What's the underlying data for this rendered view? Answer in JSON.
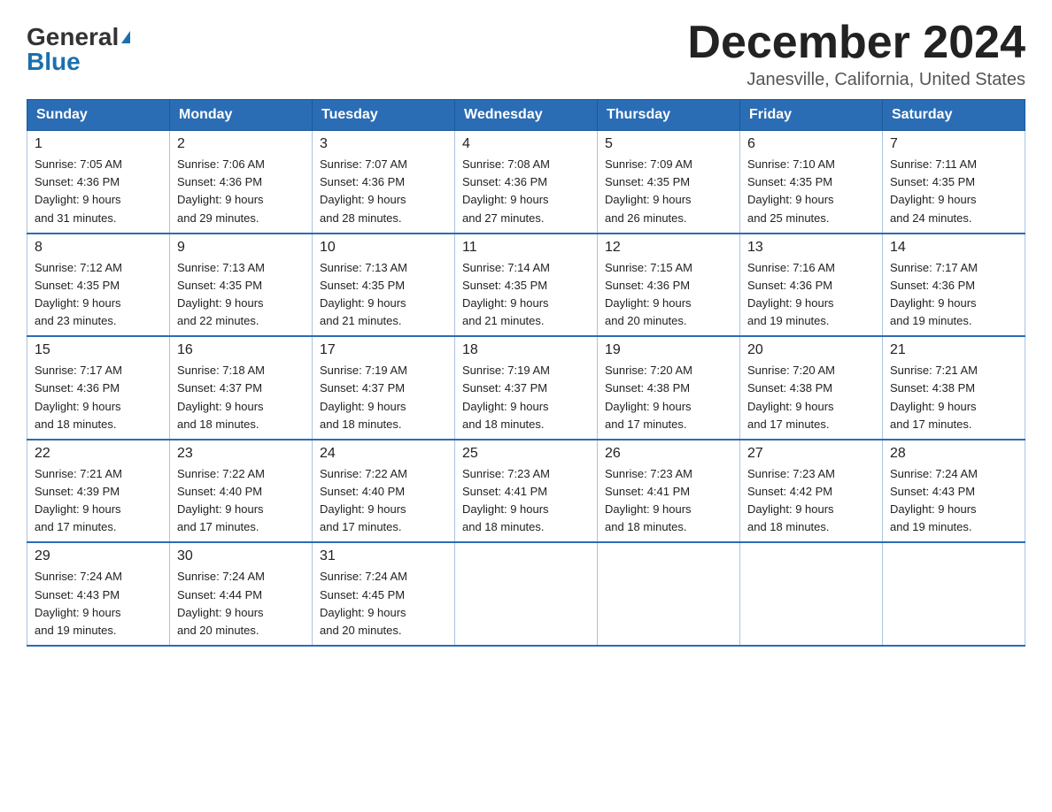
{
  "logo": {
    "general": "General",
    "blue": "Blue"
  },
  "title": "December 2024",
  "location": "Janesville, California, United States",
  "days_of_week": [
    "Sunday",
    "Monday",
    "Tuesday",
    "Wednesday",
    "Thursday",
    "Friday",
    "Saturday"
  ],
  "weeks": [
    [
      {
        "day": "1",
        "sunrise": "7:05 AM",
        "sunset": "4:36 PM",
        "daylight": "9 hours and 31 minutes."
      },
      {
        "day": "2",
        "sunrise": "7:06 AM",
        "sunset": "4:36 PM",
        "daylight": "9 hours and 29 minutes."
      },
      {
        "day": "3",
        "sunrise": "7:07 AM",
        "sunset": "4:36 PM",
        "daylight": "9 hours and 28 minutes."
      },
      {
        "day": "4",
        "sunrise": "7:08 AM",
        "sunset": "4:36 PM",
        "daylight": "9 hours and 27 minutes."
      },
      {
        "day": "5",
        "sunrise": "7:09 AM",
        "sunset": "4:35 PM",
        "daylight": "9 hours and 26 minutes."
      },
      {
        "day": "6",
        "sunrise": "7:10 AM",
        "sunset": "4:35 PM",
        "daylight": "9 hours and 25 minutes."
      },
      {
        "day": "7",
        "sunrise": "7:11 AM",
        "sunset": "4:35 PM",
        "daylight": "9 hours and 24 minutes."
      }
    ],
    [
      {
        "day": "8",
        "sunrise": "7:12 AM",
        "sunset": "4:35 PM",
        "daylight": "9 hours and 23 minutes."
      },
      {
        "day": "9",
        "sunrise": "7:13 AM",
        "sunset": "4:35 PM",
        "daylight": "9 hours and 22 minutes."
      },
      {
        "day": "10",
        "sunrise": "7:13 AM",
        "sunset": "4:35 PM",
        "daylight": "9 hours and 21 minutes."
      },
      {
        "day": "11",
        "sunrise": "7:14 AM",
        "sunset": "4:35 PM",
        "daylight": "9 hours and 21 minutes."
      },
      {
        "day": "12",
        "sunrise": "7:15 AM",
        "sunset": "4:36 PM",
        "daylight": "9 hours and 20 minutes."
      },
      {
        "day": "13",
        "sunrise": "7:16 AM",
        "sunset": "4:36 PM",
        "daylight": "9 hours and 19 minutes."
      },
      {
        "day": "14",
        "sunrise": "7:17 AM",
        "sunset": "4:36 PM",
        "daylight": "9 hours and 19 minutes."
      }
    ],
    [
      {
        "day": "15",
        "sunrise": "7:17 AM",
        "sunset": "4:36 PM",
        "daylight": "9 hours and 18 minutes."
      },
      {
        "day": "16",
        "sunrise": "7:18 AM",
        "sunset": "4:37 PM",
        "daylight": "9 hours and 18 minutes."
      },
      {
        "day": "17",
        "sunrise": "7:19 AM",
        "sunset": "4:37 PM",
        "daylight": "9 hours and 18 minutes."
      },
      {
        "day": "18",
        "sunrise": "7:19 AM",
        "sunset": "4:37 PM",
        "daylight": "9 hours and 18 minutes."
      },
      {
        "day": "19",
        "sunrise": "7:20 AM",
        "sunset": "4:38 PM",
        "daylight": "9 hours and 17 minutes."
      },
      {
        "day": "20",
        "sunrise": "7:20 AM",
        "sunset": "4:38 PM",
        "daylight": "9 hours and 17 minutes."
      },
      {
        "day": "21",
        "sunrise": "7:21 AM",
        "sunset": "4:38 PM",
        "daylight": "9 hours and 17 minutes."
      }
    ],
    [
      {
        "day": "22",
        "sunrise": "7:21 AM",
        "sunset": "4:39 PM",
        "daylight": "9 hours and 17 minutes."
      },
      {
        "day": "23",
        "sunrise": "7:22 AM",
        "sunset": "4:40 PM",
        "daylight": "9 hours and 17 minutes."
      },
      {
        "day": "24",
        "sunrise": "7:22 AM",
        "sunset": "4:40 PM",
        "daylight": "9 hours and 17 minutes."
      },
      {
        "day": "25",
        "sunrise": "7:23 AM",
        "sunset": "4:41 PM",
        "daylight": "9 hours and 18 minutes."
      },
      {
        "day": "26",
        "sunrise": "7:23 AM",
        "sunset": "4:41 PM",
        "daylight": "9 hours and 18 minutes."
      },
      {
        "day": "27",
        "sunrise": "7:23 AM",
        "sunset": "4:42 PM",
        "daylight": "9 hours and 18 minutes."
      },
      {
        "day": "28",
        "sunrise": "7:24 AM",
        "sunset": "4:43 PM",
        "daylight": "9 hours and 19 minutes."
      }
    ],
    [
      {
        "day": "29",
        "sunrise": "7:24 AM",
        "sunset": "4:43 PM",
        "daylight": "9 hours and 19 minutes."
      },
      {
        "day": "30",
        "sunrise": "7:24 AM",
        "sunset": "4:44 PM",
        "daylight": "9 hours and 20 minutes."
      },
      {
        "day": "31",
        "sunrise": "7:24 AM",
        "sunset": "4:45 PM",
        "daylight": "9 hours and 20 minutes."
      },
      null,
      null,
      null,
      null
    ]
  ],
  "labels": {
    "sunrise": "Sunrise:",
    "sunset": "Sunset:",
    "daylight": "Daylight:"
  }
}
